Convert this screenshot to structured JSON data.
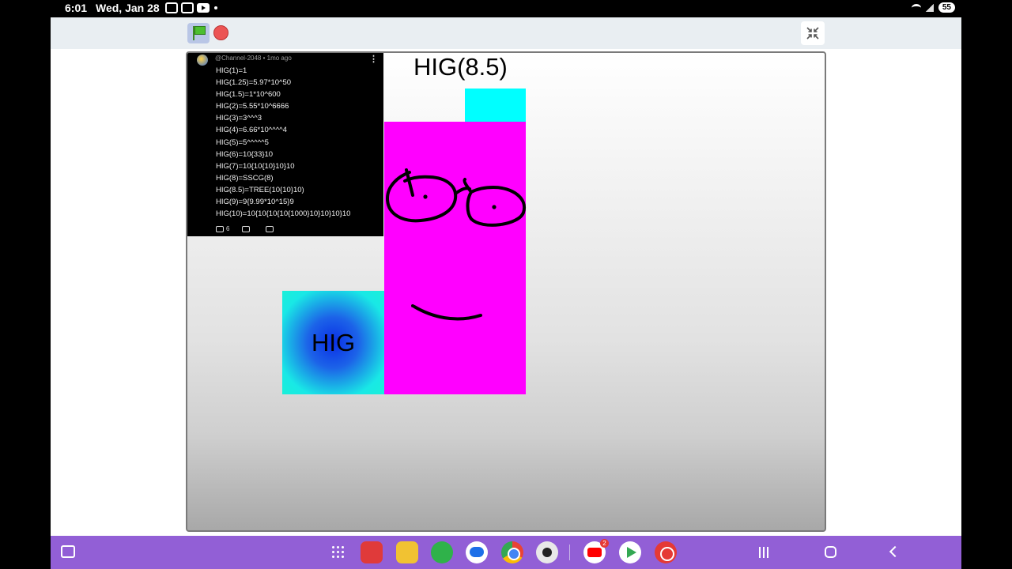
{
  "status_bar": {
    "time": "6:01",
    "date": "Wed, Jan 28",
    "battery": "55"
  },
  "toolbar": {
    "green_flag_icon": "green-flag-icon",
    "stop_icon": "stop-sign-icon",
    "fullscreen_exit_icon": "fullscreen-exit-icon"
  },
  "stage": {
    "title": "HIG(8.5)",
    "character_label": "HIG",
    "colors": {
      "magenta": "#ff00ff",
      "cyan": "#00ffff",
      "blue": "#0a2fe6"
    },
    "comment": {
      "meta": "@Channel-2048 • 1mo ago",
      "lines": [
        "HIG(1)=1",
        "HIG(1.25)=5.97*10^50",
        "HIG(1.5)=1*10^600",
        "HIG(2)=5.55*10^6666",
        "HIG(3)=3^^^3",
        "HIG(4)=6.66*10^^^^4",
        "HIG(5)=5^^^^^5",
        "HIG(6)=10{33}10",
        "HIG(7)=10{10{10}10}10",
        "HIG(8)=SSCG(8)",
        "HIG(8.5)=TREE(10{10}10)",
        "HIG(9)=9{9.99*10^15}9",
        "HIG(10)=10{10{10{10{1000}10}10}10}10"
      ],
      "likes": "6"
    }
  },
  "nav_bar": {
    "youtube_badge": "2",
    "apps": [
      "notes-app-icon",
      "files-app-icon",
      "phone-app-icon",
      "messages-app-icon",
      "chrome-app-icon",
      "camera-app-icon",
      "youtube-app-icon",
      "play-store-app-icon",
      "kinemaster-app-icon"
    ]
  }
}
